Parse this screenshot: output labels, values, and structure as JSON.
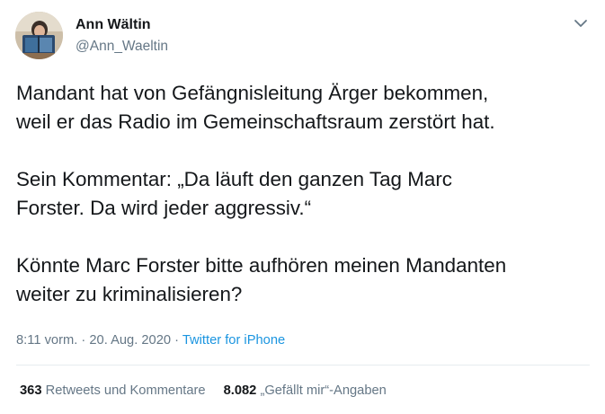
{
  "author": {
    "name": "Ann Wältin",
    "handle": "@Ann_Waeltin",
    "avatar_icon": "avatar-photo"
  },
  "menu_icon": "chevron-down-icon",
  "tweet": {
    "paragraphs": [
      "Mandant hat von Gefängnisleitung Ärger bekommen,\nweil er das Radio im Gemeinschaftsraum zerstört hat.",
      "Sein Kommentar: „Da läuft den ganzen Tag Marc\nForster. Da wird jeder aggressiv.“",
      "Könnte Marc Forster bitte aufhören meinen Mandanten\nweiter zu kriminalisieren?"
    ]
  },
  "meta": {
    "time": "8:11 vorm.",
    "separator": "·",
    "date": "20. Aug. 2020",
    "source": "Twitter for iPhone"
  },
  "stats": {
    "retweets_count": "363",
    "retweets_label": "Retweets und Kommentare",
    "likes_count": "8.082",
    "likes_label": "„Gefällt mir“-Angaben"
  },
  "colors": {
    "text": "#14171a",
    "secondary": "#657786",
    "link": "#1b95e0",
    "divider": "#e6ecf0"
  }
}
